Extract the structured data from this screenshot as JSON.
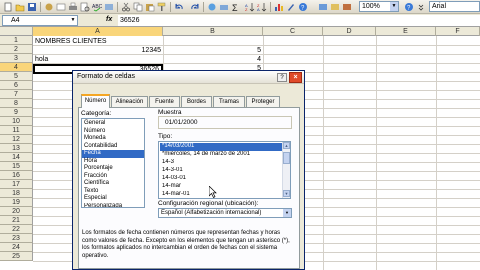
{
  "toolbar": {
    "zoom": "100%",
    "font": "Arial"
  },
  "formula_bar": {
    "name_box": "A4",
    "fx": "fx",
    "value": "36526"
  },
  "grid": {
    "columns": [
      "A",
      "B",
      "C",
      "D",
      "E",
      "F"
    ],
    "rows": [
      "1",
      "2",
      "3",
      "4",
      "5",
      "6",
      "7",
      "8",
      "9",
      "10",
      "11",
      "12",
      "13",
      "14",
      "15",
      "16",
      "17",
      "18",
      "19",
      "20",
      "21",
      "22",
      "23",
      "24",
      "25"
    ],
    "cells": {
      "a1": "NOMBRES CLIENTES",
      "a2": "12345",
      "b2": "5",
      "a3": "hola",
      "b3": "4",
      "a4": "36526",
      "b4": "5"
    }
  },
  "dialog": {
    "title": "Formato de celdas",
    "help": "?",
    "close": "×",
    "tabs": [
      "Número",
      "Alineación",
      "Fuente",
      "Bordes",
      "Tramas",
      "Proteger"
    ],
    "category_label": "Categoría:",
    "categories": [
      "General",
      "Número",
      "Moneda",
      "Contabilidad",
      "Fecha",
      "Hora",
      "Porcentaje",
      "Fracción",
      "Científica",
      "Texto",
      "Especial",
      "Personalizada"
    ],
    "selected_category": "Fecha",
    "sample_label": "Muestra",
    "sample_value": "01/01/2000",
    "type_label": "Tipo:",
    "types": [
      "*14/03/2001",
      "*miércoles, 14 de marzo de 2001",
      "14-3",
      "14-3-01",
      "14-03-01",
      "14-mar",
      "14-mar-01"
    ],
    "selected_type": "*14/03/2001",
    "locale_label": "Configuración regional (ubicación):",
    "locale_value": "Español (Alfabetización internacional)",
    "description": "Los formatos de fecha contienen números que representan fechas y horas como valores de fecha. Excepto en los elementos que tengan un asterisco (*), los formatos aplicados no intercambian el orden de fechas con el sistema operativo."
  },
  "colors": {
    "selection": "#316ac5",
    "tab_accent": "#f5a623",
    "close": "#e04a2a"
  }
}
